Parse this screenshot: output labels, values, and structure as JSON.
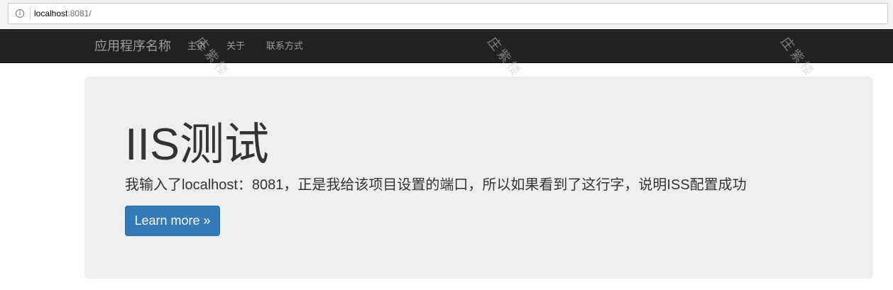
{
  "browser": {
    "url_host": "localhost",
    "url_rest": ":8081/",
    "info_icon": "info-icon"
  },
  "navbar": {
    "brand": "应用程序名称",
    "links": [
      "主页",
      "关于",
      "联系方式"
    ]
  },
  "jumbotron": {
    "title": "IIS测试",
    "lead": "我输入了localhost：8081，正是我给该项目设置的端口，所以如果看到了这行字，说明ISS配置成功",
    "button_label": "Learn more »"
  },
  "watermark": "庄紫楼",
  "colors": {
    "navbar_bg": "#222222",
    "navbar_text": "#9d9d9d",
    "jumbotron_bg": "#eeeeee",
    "primary_button": "#337ab7"
  }
}
